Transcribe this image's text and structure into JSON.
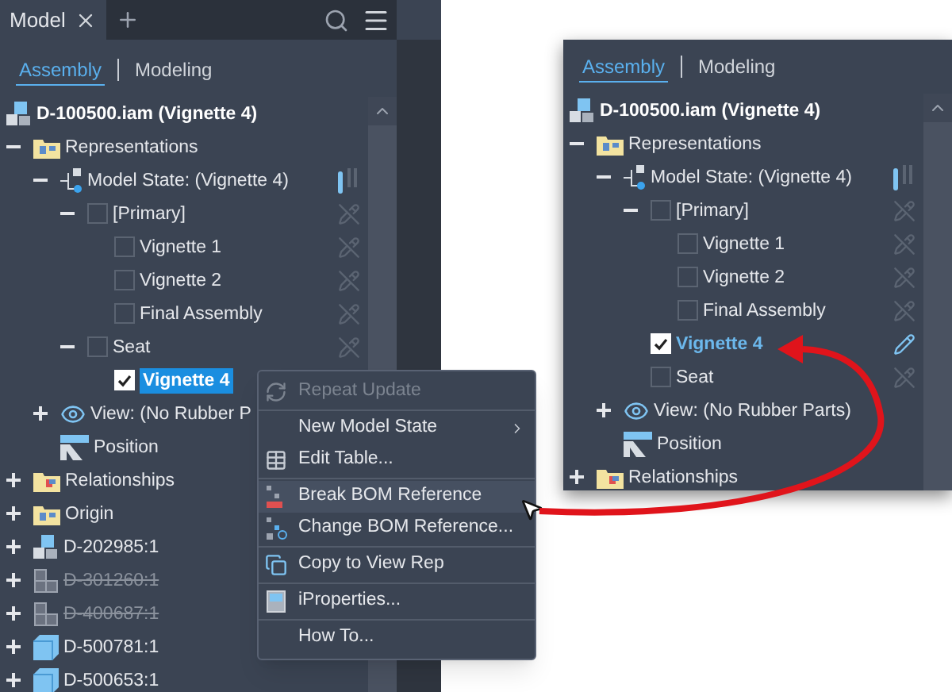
{
  "left_panel": {
    "tab": {
      "label": "Model"
    },
    "subtabs": [
      {
        "label": "Assembly",
        "selected": true
      },
      {
        "label": "Modeling",
        "selected": false
      }
    ],
    "tree": [
      {
        "label": "D-100500.iam (Vignette 4)",
        "kind": "assembly",
        "selected": false,
        "children": [
          {
            "label": "Representations",
            "kind": "folder_rep",
            "expanded": true,
            "selected": false,
            "children": [
              {
                "label": "Model State: (Vignette 4)",
                "kind": "model_state",
                "expanded": true,
                "selected": false,
                "children": [
                  {
                    "label": "[Primary]",
                    "kind": "state",
                    "expanded": true,
                    "checked": false,
                    "active": false,
                    "selected": false,
                    "children": [
                      {
                        "label": "Vignette 1",
                        "kind": "state",
                        "checked": false,
                        "active": false,
                        "selected": false
                      },
                      {
                        "label": "Vignette 2",
                        "kind": "state",
                        "checked": false,
                        "active": false,
                        "selected": false
                      },
                      {
                        "label": "Final Assembly",
                        "kind": "state",
                        "checked": false,
                        "active": false,
                        "selected": false
                      }
                    ]
                  },
                  {
                    "label": "Seat",
                    "kind": "state",
                    "expanded": true,
                    "checked": false,
                    "active": false,
                    "selected": false,
                    "children": [
                      {
                        "label": "Vignette 4",
                        "kind": "state",
                        "checked": true,
                        "active": true,
                        "selected": true
                      }
                    ]
                  }
                ]
              },
              {
                "label": "View: (No Rubber P",
                "kind": "view",
                "expanded": false,
                "selected": false
              },
              {
                "label": "Position",
                "kind": "position",
                "selected": false
              }
            ]
          },
          {
            "label": "Relationships",
            "kind": "folder_rel",
            "expanded": false,
            "selected": false
          },
          {
            "label": "Origin",
            "kind": "folder_origin",
            "expanded": false,
            "selected": false
          },
          {
            "label": "D-202985:1",
            "kind": "subassembly",
            "expanded": false,
            "suppressed": false,
            "selected": false
          },
          {
            "label": "D-301260:1",
            "kind": "subassembly",
            "expanded": false,
            "suppressed": true,
            "selected": false
          },
          {
            "label": "D-400687:1",
            "kind": "subassembly",
            "expanded": false,
            "suppressed": true,
            "selected": false
          },
          {
            "label": "D-500781:1",
            "kind": "part",
            "expanded": false,
            "suppressed": false,
            "selected": false
          },
          {
            "label": "D-500653:1",
            "kind": "part",
            "expanded": false,
            "suppressed": false,
            "selected": false
          }
        ]
      }
    ]
  },
  "context_menu": {
    "groups": [
      [
        {
          "label": "Repeat Update",
          "kind": "repeat",
          "disabled": true,
          "submenu": false,
          "hovered": false
        }
      ],
      [
        {
          "label": "New Model State",
          "kind": "plain",
          "disabled": false,
          "submenu": true,
          "hovered": false
        },
        {
          "label": "Edit Table...",
          "kind": "table",
          "disabled": false,
          "submenu": false,
          "hovered": false
        }
      ],
      [
        {
          "label": "Break BOM Reference",
          "kind": "break",
          "disabled": false,
          "submenu": false,
          "hovered": true
        },
        {
          "label": "Change BOM Reference...",
          "kind": "change",
          "disabled": false,
          "submenu": false,
          "hovered": false
        }
      ],
      [
        {
          "label": "Copy to View Rep",
          "kind": "copy",
          "disabled": false,
          "submenu": false,
          "hovered": false
        }
      ],
      [
        {
          "label": "iProperties...",
          "kind": "props",
          "disabled": false,
          "submenu": false,
          "hovered": false
        }
      ],
      [
        {
          "label": "How To...",
          "kind": "plain",
          "disabled": false,
          "submenu": false,
          "hovered": false
        }
      ]
    ]
  },
  "right_panel": {
    "subtabs": [
      {
        "label": "Assembly",
        "selected": true
      },
      {
        "label": "Modeling",
        "selected": false
      }
    ],
    "tree": [
      {
        "label": "D-100500.iam (Vignette 4)",
        "kind": "assembly",
        "selected": false,
        "children": [
          {
            "label": "Representations",
            "kind": "folder_rep",
            "expanded": true,
            "selected": false,
            "children": [
              {
                "label": "Model State: (Vignette 4)",
                "kind": "model_state",
                "expanded": true,
                "selected": false,
                "children": [
                  {
                    "label": "[Primary]",
                    "kind": "state",
                    "expanded": true,
                    "checked": false,
                    "active": false,
                    "selected": false,
                    "children": [
                      {
                        "label": "Vignette 1",
                        "kind": "state",
                        "checked": false,
                        "active": false,
                        "selected": false
                      },
                      {
                        "label": "Vignette 2",
                        "kind": "state",
                        "checked": false,
                        "active": false,
                        "selected": false
                      },
                      {
                        "label": "Final Assembly",
                        "kind": "state",
                        "checked": false,
                        "active": false,
                        "selected": false
                      }
                    ]
                  },
                  {
                    "label": "Vignette 4",
                    "kind": "state",
                    "checked": true,
                    "active": true,
                    "selected": false
                  },
                  {
                    "label": "Seat",
                    "kind": "state",
                    "checked": false,
                    "active": false,
                    "selected": false
                  }
                ]
              },
              {
                "label": "View: (No Rubber Parts)",
                "kind": "view",
                "expanded": false,
                "selected": false
              },
              {
                "label": "Position",
                "kind": "position",
                "selected": false
              }
            ]
          },
          {
            "label": "Relationships",
            "kind": "folder_rel",
            "expanded": false,
            "selected": false
          }
        ]
      }
    ]
  }
}
